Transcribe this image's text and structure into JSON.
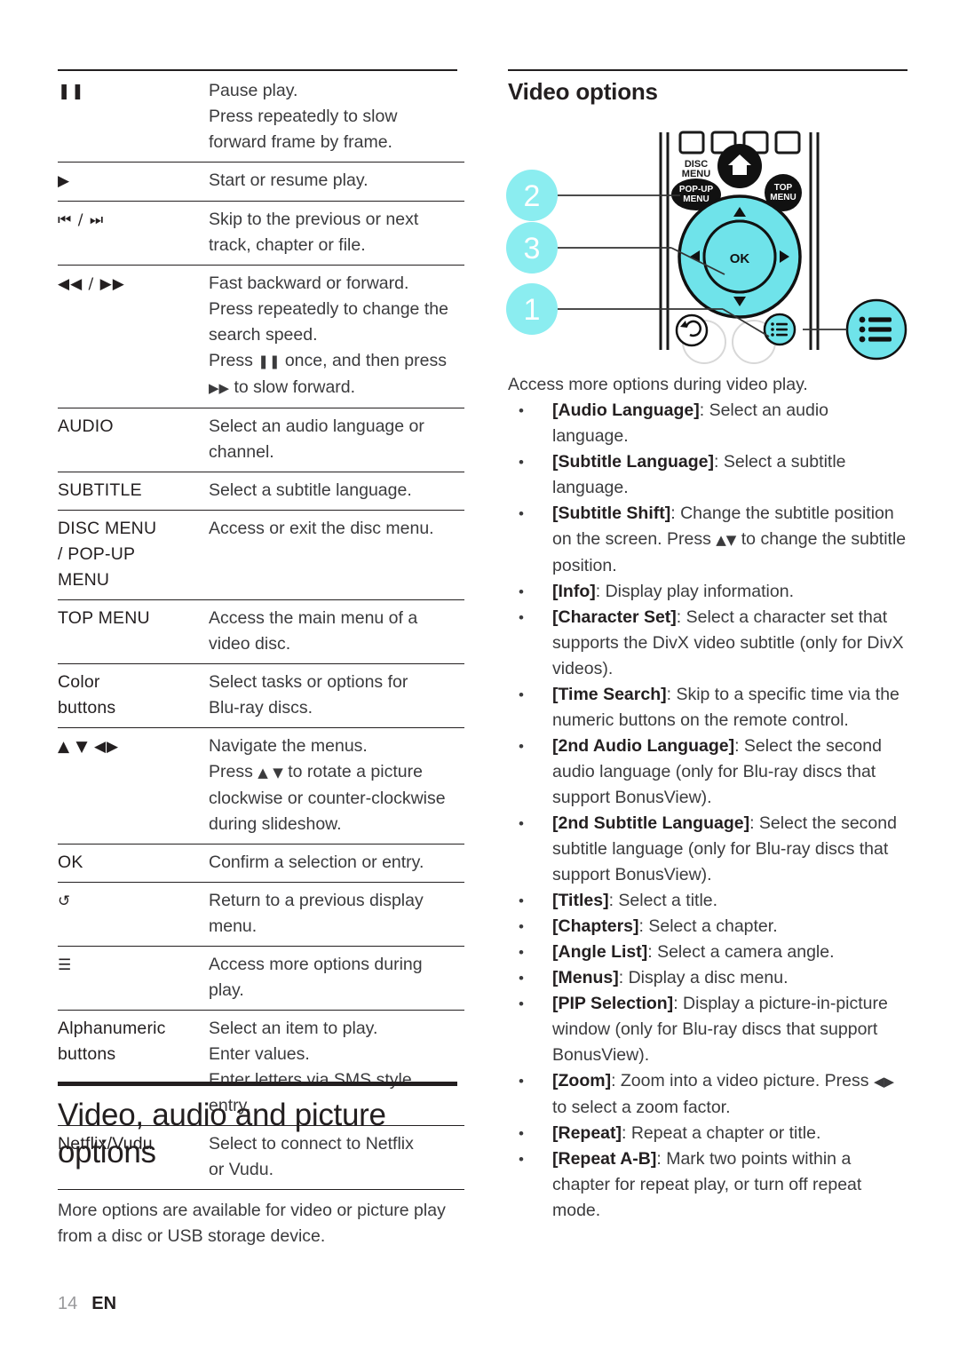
{
  "page": {
    "number": "14",
    "language": "EN"
  },
  "left_column": {
    "button_table": {
      "rows": [
        {
          "key": "❚❚",
          "key_type": "glyph",
          "key_name": "pause-icon",
          "lines": [
            "Pause play.",
            "Press repeatedly to slow",
            "forward frame by frame."
          ]
        },
        {
          "key": "▶",
          "key_type": "glyph",
          "key_name": "play-icon",
          "lines": [
            "Start or resume play."
          ]
        },
        {
          "key": "⏮ / ⏭",
          "key_type": "glyph",
          "key_name": "skip-previous-next-icon",
          "lines": [
            "Skip to the previous or next",
            "track, chapter or file."
          ]
        },
        {
          "key": "◀◀ / ▶▶",
          "key_type": "glyph",
          "key_name": "rewind-fast-forward-icon",
          "lines": [
            "Fast backward or forward.",
            "Press repeatedly to change the",
            "search speed.",
            "Press ❚❚ once, and then press",
            "▶▶ to slow forward."
          ]
        },
        {
          "key": "AUDIO",
          "key_type": "text",
          "key_name": "audio-button",
          "lines": [
            "Select an audio language or",
            "channel."
          ]
        },
        {
          "key": "SUBTITLE",
          "key_type": "text",
          "key_name": "subtitle-button",
          "lines": [
            "Select a subtitle language."
          ]
        },
        {
          "key": "DISC MENU\n/ POP-UP\nMENU",
          "key_type": "text",
          "key_name": "disc-menu-popup-menu-button",
          "lines": [
            "Access or exit the disc menu."
          ]
        },
        {
          "key": "TOP MENU",
          "key_type": "text",
          "key_name": "top-menu-button",
          "lines": [
            "Access the main menu of a",
            "video disc."
          ]
        },
        {
          "key": "Color\nbuttons",
          "key_type": "text",
          "key_name": "color-buttons",
          "lines": [
            "Select tasks or options for",
            "Blu-ray discs."
          ]
        },
        {
          "key": "▲ ▼ ◀▶",
          "key_type": "glyph",
          "key_name": "navigation-arrows-icon",
          "lines": [
            "Navigate the menus.",
            "Press ▲ ▼ to rotate a picture",
            "clockwise or counter-clockwise",
            "during slideshow."
          ]
        },
        {
          "key": "OK",
          "key_type": "text",
          "key_name": "ok-button",
          "lines": [
            "Confirm a selection or entry."
          ]
        },
        {
          "key": "↺",
          "key_type": "glyph",
          "key_name": "return-back-icon",
          "lines": [
            "Return to a previous display",
            "menu."
          ]
        },
        {
          "key": "☰",
          "key_type": "glyph",
          "key_name": "options-list-icon",
          "lines": [
            "Access more options during",
            "play."
          ]
        },
        {
          "key": "Alphanumeric\nbuttons",
          "key_type": "text",
          "key_name": "alphanumeric-buttons",
          "lines": [
            "Select an item to play.",
            "Enter values.",
            "Enter letters via SMS style",
            "entry."
          ]
        },
        {
          "key": "Netflix/Vudu",
          "key_type": "text",
          "key_name": "netflix-vudu-button",
          "lines": [
            "Select to connect to Netflix",
            "or Vudu."
          ]
        }
      ]
    },
    "section": {
      "title": "Video, audio and picture options",
      "body": "More options are available for video or picture play from a disc or USB storage device."
    }
  },
  "right_column": {
    "title": "Video options",
    "intro": "Access more options during video play.",
    "remote": {
      "callouts": [
        {
          "number": "2",
          "target": "navigation-pad"
        },
        {
          "number": "3",
          "target": "ok-button"
        },
        {
          "number": "1",
          "target": "options-button"
        }
      ],
      "labels": {
        "disc_menu": "DISC\nMENU",
        "popup_menu": "POP-UP\nMENU",
        "top_menu": "TOP\nMENU",
        "ok": "OK"
      },
      "colors": {
        "accent": "#6FE3EA",
        "callout": "#8BEDF0",
        "ink": "#000000"
      }
    },
    "options": [
      {
        "term": "[Audio Language]",
        "desc": ": Select an audio language."
      },
      {
        "term": "[Subtitle Language]",
        "desc": ": Select a subtitle language."
      },
      {
        "term": "[Subtitle Shift]",
        "desc": ": Change the subtitle position on the screen. Press ▲▼ to change the subtitle position."
      },
      {
        "term": "[Info]",
        "desc": ": Display play information."
      },
      {
        "term": "[Character Set]",
        "desc": ": Select a character set that supports the DivX video subtitle (only for DivX videos)."
      },
      {
        "term": "[Time Search]",
        "desc": ": Skip to a specific time via the numeric buttons on the remote control."
      },
      {
        "term": "[2nd Audio Language]",
        "desc": ": Select the second audio language (only for Blu-ray discs that support BonusView)."
      },
      {
        "term": "[2nd Subtitle Language]",
        "desc": ": Select the second subtitle language (only for Blu-ray discs that support BonusView)."
      },
      {
        "term": "[Titles]",
        "desc": ": Select a title."
      },
      {
        "term": "[Chapters]",
        "desc": ": Select a chapter."
      },
      {
        "term": "[Angle List]",
        "desc": ": Select a camera angle."
      },
      {
        "term": "[Menus]",
        "desc": ": Display a disc menu."
      },
      {
        "term": "[PIP Selection]",
        "desc": ": Display a picture-in-picture window (only for Blu-ray discs that support BonusView)."
      },
      {
        "term": "[Zoom]",
        "desc": ": Zoom into a video picture. Press ◀▶ to select a zoom factor."
      },
      {
        "term": "[Repeat]",
        "desc": ": Repeat a chapter or title."
      },
      {
        "term": "[Repeat A-B]",
        "desc": ": Mark two points within a chapter for repeat play, or turn off repeat mode."
      }
    ]
  }
}
